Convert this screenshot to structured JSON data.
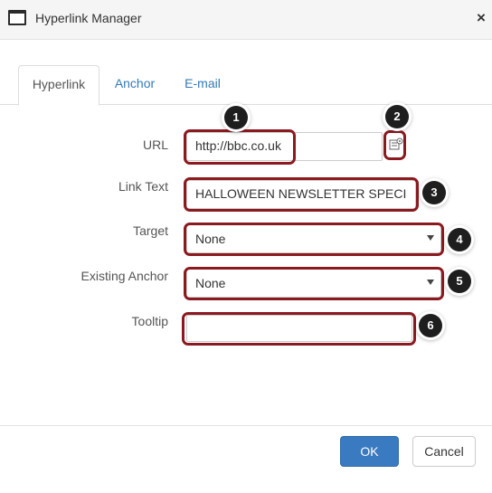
{
  "window": {
    "title": "Hyperlink Manager",
    "close_symbol": "×"
  },
  "tabs": [
    {
      "label": "Hyperlink",
      "active": true
    },
    {
      "label": "Anchor",
      "active": false
    },
    {
      "label": "E-mail",
      "active": false
    }
  ],
  "form": {
    "url": {
      "label": "URL",
      "value": "http://bbc.co.uk"
    },
    "link_text": {
      "label": "Link Text",
      "value": "HALLOWEEN NEWSLETTER SPECI"
    },
    "target": {
      "label": "Target",
      "value": "None"
    },
    "existing_anchor": {
      "label": "Existing Anchor",
      "value": "None"
    },
    "tooltip": {
      "label": "Tooltip",
      "value": ""
    }
  },
  "badges": [
    "1",
    "2",
    "3",
    "4",
    "5",
    "6"
  ],
  "buttons": {
    "ok": "OK",
    "cancel": "Cancel"
  },
  "colors": {
    "highlight": "#8b1a20",
    "ok_button": "#3a7ac1",
    "tab_link": "#337ab7"
  },
  "icons": {
    "window": "window-icon",
    "close": "close-icon",
    "url_picker": "document-picker-icon",
    "dropdown": "chevron-down-icon"
  }
}
